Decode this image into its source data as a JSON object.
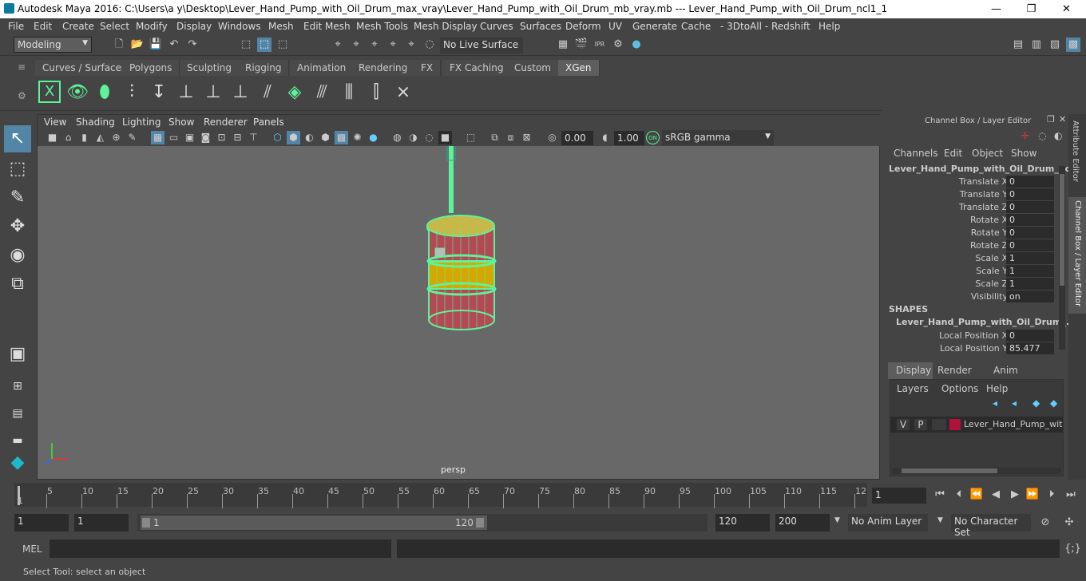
{
  "window": {
    "title": "Autodesk Maya 2016: C:\\Users\\a y\\Desktop\\Lever_Hand_Pump_with_Oil_Drum_max_vray\\Lever_Hand_Pump_with_Oil_Drum_mb_vray.mb   ---   Lever_Hand_Pump_with_Oil_Drum_ncl1_1",
    "minimize": "—",
    "maximize": "❐",
    "close": "✕"
  },
  "menubar": [
    "File",
    "Edit",
    "Create",
    "Select",
    "Modify",
    "Display",
    "Windows",
    "Mesh",
    "Edit Mesh",
    "Mesh Tools",
    "Mesh Display",
    "Curves",
    "Surfaces",
    "Deform",
    "UV",
    "Generate",
    "Cache",
    "- 3DtoAll -",
    "Redshift",
    "Help"
  ],
  "statusline": {
    "mode": "Modeling",
    "live_surface": "No Live Surface"
  },
  "shelf_tabs": [
    "Curves / Surfaces",
    "Polygons",
    "Sculpting",
    "Rigging",
    "Animation",
    "Rendering",
    "FX",
    "FX Caching",
    "Custom",
    "XGen"
  ],
  "shelf_active": "XGen",
  "viewport": {
    "menu": [
      "View",
      "Shading",
      "Lighting",
      "Show",
      "Renderer",
      "Panels"
    ],
    "exposure": "0.00",
    "gamma": "1.00",
    "colorspace": "sRGB gamma",
    "camera_label": "persp"
  },
  "channel_box": {
    "header": "Channel Box / Layer Editor",
    "menu": [
      "Channels",
      "Edit",
      "Object",
      "Show"
    ],
    "object_name": "Lever_Hand_Pump_with_Oil_Drum_ncl...",
    "attributes": [
      {
        "label": "Translate X",
        "value": "0"
      },
      {
        "label": "Translate Y",
        "value": "0"
      },
      {
        "label": "Translate Z",
        "value": "0"
      },
      {
        "label": "Rotate X",
        "value": "0"
      },
      {
        "label": "Rotate Y",
        "value": "0"
      },
      {
        "label": "Rotate Z",
        "value": "0"
      },
      {
        "label": "Scale X",
        "value": "1"
      },
      {
        "label": "Scale Y",
        "value": "1"
      },
      {
        "label": "Scale Z",
        "value": "1"
      },
      {
        "label": "Visibility",
        "value": "on"
      }
    ],
    "shapes_title": "SHAPES",
    "shape_name": "Lever_Hand_Pump_with_Oil_Drum_...",
    "shape_attributes": [
      {
        "label": "Local Position X",
        "value": "0"
      },
      {
        "label": "Local Position Y",
        "value": "85.477"
      }
    ]
  },
  "layer_editor": {
    "tabs": [
      "Display",
      "Render",
      "Anim"
    ],
    "active_tab": "Display",
    "menu": [
      "Layers",
      "Options",
      "Help"
    ],
    "layer": {
      "v": "V",
      "p": "P",
      "name": "Lever_Hand_Pump_with_",
      "color": "#b0123c"
    }
  },
  "side_tabs": [
    "Attribute Editor",
    "Channel Box / Layer Editor"
  ],
  "timeline": {
    "ticks": [
      "1",
      "5",
      "10",
      "15",
      "20",
      "25",
      "30",
      "35",
      "40",
      "45",
      "50",
      "55",
      "60",
      "65",
      "70",
      "75",
      "80",
      "85",
      "90",
      "95",
      "100",
      "105",
      "110",
      "115",
      "12"
    ],
    "current_frame": "1"
  },
  "range": {
    "start": "1",
    "playback_start": "1",
    "slider_start": "1",
    "slider_end": "120",
    "playback_end": "120",
    "end": "200",
    "anim_layer": "No Anim Layer",
    "character_set": "No Character Set"
  },
  "cmdline": {
    "label": "MEL"
  },
  "helpline": {
    "text": "Select Tool: select an object"
  },
  "colors": {
    "wire": "#5ef29a",
    "drum_red": "#b24a56",
    "drum_yellow": "#d4a800",
    "accent": "#5285a6"
  }
}
